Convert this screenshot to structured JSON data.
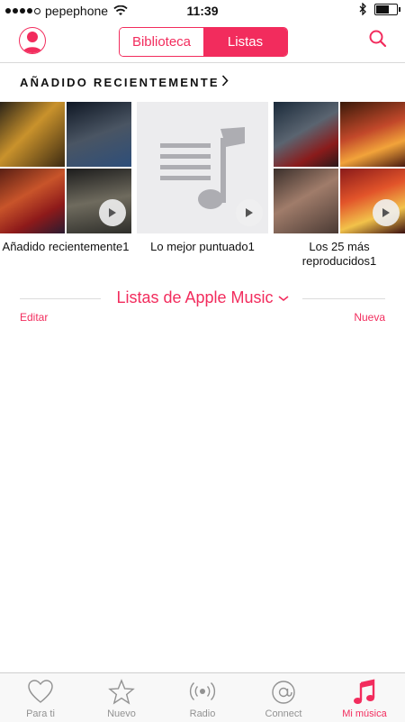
{
  "status": {
    "carrier": "pepephone",
    "time": "11:39"
  },
  "nav": {
    "segments": [
      "Biblioteca",
      "Listas"
    ],
    "active_segment": "Listas"
  },
  "section": {
    "title": "AÑADIDO RECIENTEMENTE",
    "items": [
      {
        "label": "Añadido recientemente1"
      },
      {
        "label": "Lo mejor puntuado1"
      },
      {
        "label": "Los 25 más reproducidos1"
      }
    ]
  },
  "apple_music": {
    "title": "Listas de Apple Music",
    "edit": "Editar",
    "new": "Nueva"
  },
  "tabbar": {
    "tabs": [
      {
        "label": "Para ti",
        "icon": "heart-icon"
      },
      {
        "label": "Nuevo",
        "icon": "star-icon"
      },
      {
        "label": "Radio",
        "icon": "radio-icon"
      },
      {
        "label": "Connect",
        "icon": "at-icon"
      },
      {
        "label": "Mi música",
        "icon": "music-note-icon"
      }
    ],
    "active": "Mi música"
  },
  "colors": {
    "accent": "#f22c5d",
    "tab_inactive": "#929292"
  }
}
